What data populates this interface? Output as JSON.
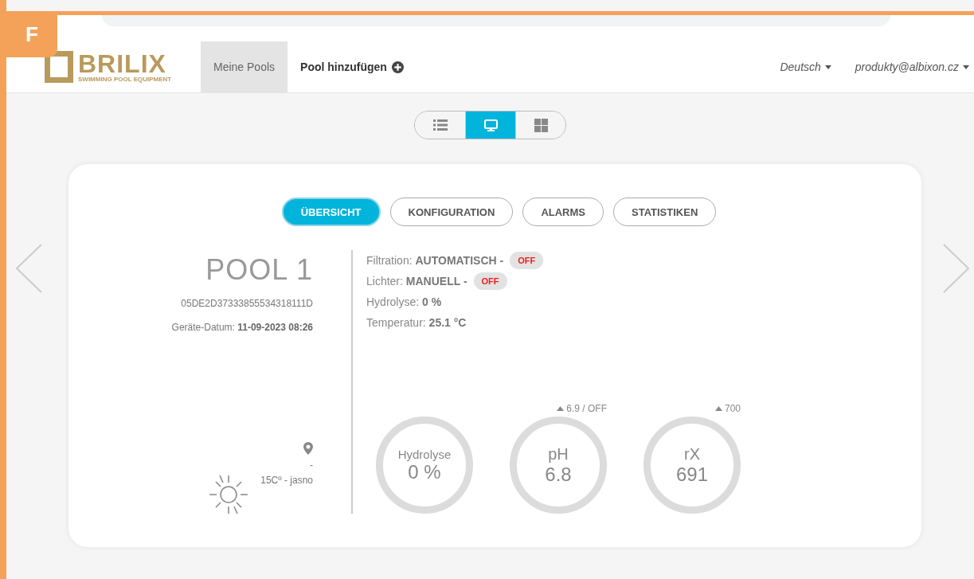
{
  "badge": "F",
  "nav": {
    "logo": {
      "name": "BRILIX",
      "tagline": "SWIMMING POOL EQUIPMENT"
    },
    "items": [
      {
        "label": "Meine Pools",
        "kind": "link",
        "selected": true
      },
      {
        "label": "Pool hinzufügen",
        "kind": "add",
        "selected": false
      }
    ],
    "language": "Deutsch",
    "account": "produkty@albixon.cz"
  },
  "view_toggle": [
    {
      "kind": "list",
      "selected": false
    },
    {
      "kind": "monitor",
      "selected": true
    },
    {
      "kind": "grid",
      "selected": false
    }
  ],
  "tabs": [
    {
      "label": "ÜBERSICHT",
      "selected": true
    },
    {
      "label": "KONFIGURATION",
      "selected": false
    },
    {
      "label": "ALARMS",
      "selected": false
    },
    {
      "label": "STATISTIKEN",
      "selected": false
    }
  ],
  "pool": {
    "name": "POOL 1",
    "serial": "05DE2D37333855534318111D",
    "date_label": "Geräte-Datum:",
    "date": "11-09-2023 08:26",
    "location": "-",
    "weather": "15Cº - jasno"
  },
  "status": [
    {
      "label": "Filtration:",
      "value": "AUTOMATISCH -",
      "badge": "OFF",
      "on": false
    },
    {
      "label": "Lichter:",
      "value": "MANUELL -",
      "badge": "OFF",
      "on": false
    },
    {
      "label": "Hydrolyse:",
      "value": "0 %"
    },
    {
      "label": "Temperatur:",
      "value": "25.1 °C"
    }
  ],
  "gauges": [
    {
      "label": "Hydrolyse",
      "value": "0 %"
    },
    {
      "label": "pH",
      "value": "6.8",
      "setpoint": "6.9 / OFF"
    },
    {
      "label": "rX",
      "value": "691",
      "setpoint": "700"
    }
  ]
}
